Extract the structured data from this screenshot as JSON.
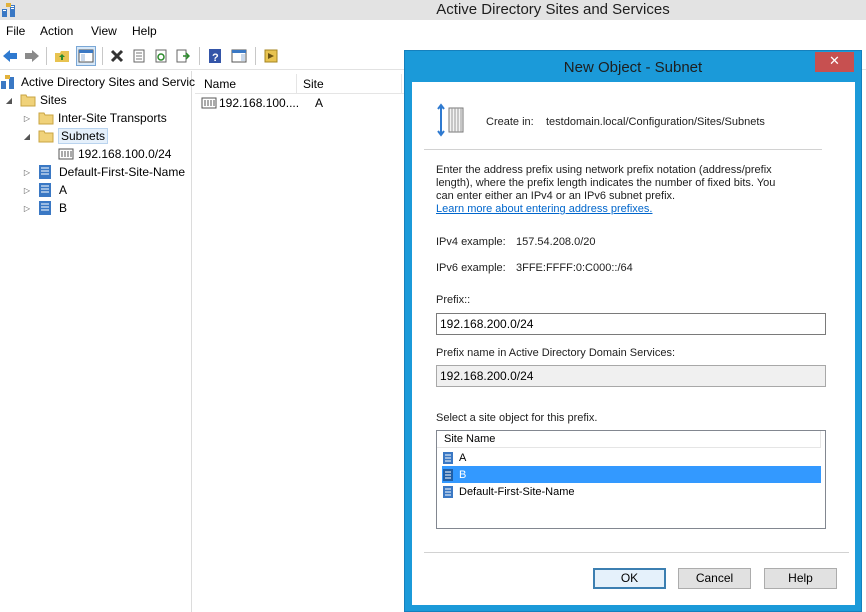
{
  "window": {
    "title": "Active Directory Sites and Services"
  },
  "menu": [
    "File",
    "Action",
    "View",
    "Help"
  ],
  "toolbar": {
    "buttons": [
      "back-icon",
      "forward-icon",
      "up-folder-icon",
      "show-hide-console-tree-icon",
      "delete-icon",
      "properties-sheet-icon",
      "refresh-icon",
      "export-list-icon",
      "help-icon",
      "action-pane-icon",
      "new-object-icon"
    ]
  },
  "tree": {
    "root": "Active Directory Sites and Servic",
    "sites": "Sites",
    "inter_site": "Inter-Site Transports",
    "subnets": "Subnets",
    "subnet_item": "192.168.100.0/24",
    "default_site": "Default-First-Site-Name",
    "site_a": "A",
    "site_b": "B"
  },
  "list": {
    "columns": [
      "Name",
      "Site"
    ],
    "rows": [
      {
        "name": "192.168.100....",
        "site": "A"
      }
    ]
  },
  "dialog": {
    "title": "New Object - Subnet",
    "close": "✕",
    "create_in_label": "Create in:",
    "create_in_path": "testdomain.local/Configuration/Sites/Subnets",
    "description": [
      "Enter the address prefix using network prefix notation (address/prefix",
      "length), where the prefix length indicates the number of fixed bits. You",
      "can enter either an IPv4 or an IPv6 subnet prefix."
    ],
    "learn_more": "Learn more about entering address prefixes.",
    "ipv4_label": "IPv4 example:",
    "ipv4_value": "157.54.208.0/20",
    "ipv6_label": "IPv6 example:",
    "ipv6_value": "3FFE:FFFF:0:C000::/64",
    "prefix_label": "Prefix::",
    "prefix_value": "192.168.200.0/24",
    "prefix_name_label": "Prefix name in Active Directory Domain Services:",
    "prefix_name_value": "192.168.200.0/24",
    "select_label": "Select a site object for this prefix.",
    "site_list_header": "Site Name",
    "sites": [
      "A",
      "B",
      "Default-First-Site-Name"
    ],
    "selected_site": "B",
    "ok": "OK",
    "cancel": "Cancel",
    "help": "Help"
  },
  "colors": {
    "accent": "#1b9ad9",
    "selection": "#3399ff",
    "close": "#c75050"
  }
}
